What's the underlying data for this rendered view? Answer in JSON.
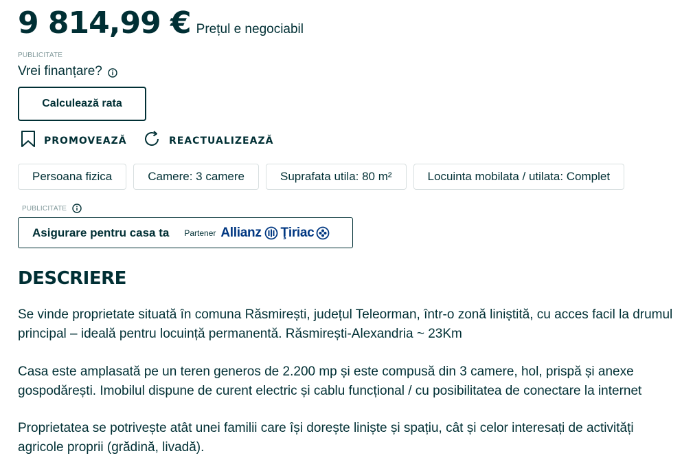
{
  "price": {
    "amount": "9 814,99 €",
    "note": "Prețul e negociabil"
  },
  "ad_label": "PUBLICITATE",
  "finance": {
    "question": "Vrei finanțare?",
    "button": "Calculează rata"
  },
  "actions": {
    "promote": "PROMOVEAZĂ",
    "refresh": "REACTUALIZEAZĂ"
  },
  "tags": [
    "Persoana fizica",
    "Camere: 3 camere",
    "Suprafata utila: 80 m²",
    "Locuinta mobilata / utilata: Complet"
  ],
  "insurance": {
    "label": "PUBLICITATE",
    "title": "Asigurare pentru casa ta",
    "partner_label": "Partener",
    "brand_left": "Allianz",
    "brand_right": "Ţiriac",
    "brand_color": "#003781"
  },
  "description": {
    "heading": "DESCRIERE",
    "paragraphs": [
      "Se vinde proprietate situată în comuna Răsmirești, județul Teleorman, într-o zonă liniștită, cu acces facil la drumul principal – ideală pentru locuință permanentă. Răsmirești-Alexandria ~ 23Km",
      "Casa este amplasată pe un teren generos de 2.200 mp și este compusă din 3 camere, hol, prispă și anexe gospodărești. Imobilul dispune de curent electric și cablu funcțional / cu posibilitatea de conectare la internet",
      "Proprietatea se potrivește atât unei familii care își dorește liniște și spațiu, cât și celor interesați de activități agricole proprii (grădină, livadă)."
    ]
  },
  "colors": {
    "text": "#002f34",
    "muted": "#7f9799",
    "border": "#d8dfe0"
  }
}
